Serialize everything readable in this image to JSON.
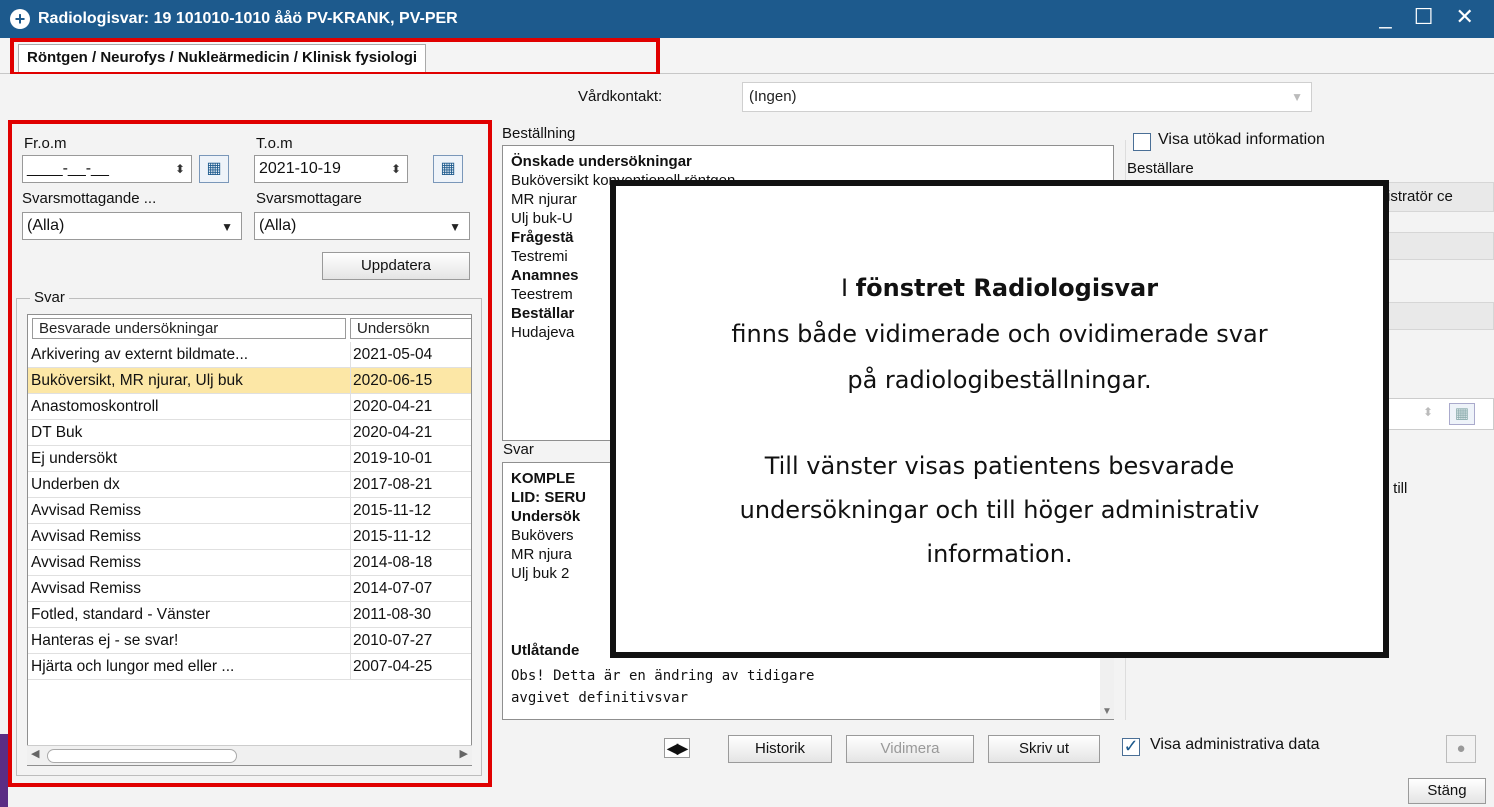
{
  "window": {
    "title": "Radiologisvar: 19 101010-1010 ååö PV-KRANK, PV-PER",
    "icon": "plus-cross-icon",
    "controls": "_ ☐ ✕"
  },
  "tabs": [
    {
      "label": "Röntgen / Neurofys / Nukleärmedicin / Klinisk fysiologi",
      "selected": true
    }
  ],
  "vardkontakt": {
    "label": "Vårdkontakt:",
    "value": "(Ingen)"
  },
  "filters": {
    "from_label": "Fr.o.m",
    "from_value": "____-__-__",
    "to_label": "T.o.m",
    "to_value": "2021-10-19",
    "recv_unit_label": "Svarsmottagande ...",
    "recv_unit_value": "(Alla)",
    "recv_label": "Svarsmottagare",
    "recv_value": "(Alla)",
    "update_button": "Uppdatera"
  },
  "svar_group": {
    "legend": "Svar",
    "columns": [
      "Besvarade undersökningar",
      "Undersökn"
    ],
    "rows": [
      {
        "name": "Arkivering av externt bildmate...",
        "date": "2021-05-04",
        "selected": false
      },
      {
        "name": "Buköversikt, MR njurar, Ulj buk",
        "date": "2020-06-15",
        "selected": true
      },
      {
        "name": "Anastomoskontroll",
        "date": "2020-04-21",
        "selected": false
      },
      {
        "name": "DT Buk",
        "date": "2020-04-21",
        "selected": false
      },
      {
        "name": "Ej undersökt",
        "date": "2019-10-01",
        "selected": false
      },
      {
        "name": "Underben dx",
        "date": "2017-08-21",
        "selected": false
      },
      {
        "name": "Avvisad Remiss",
        "date": "2015-11-12",
        "selected": false
      },
      {
        "name": "Avvisad Remiss",
        "date": "2015-11-12",
        "selected": false
      },
      {
        "name": "Avvisad Remiss",
        "date": "2014-08-18",
        "selected": false
      },
      {
        "name": "Avvisad Remiss",
        "date": "2014-07-07",
        "selected": false
      },
      {
        "name": "Fotled, standard - Vänster",
        "date": "2011-08-30",
        "selected": false
      },
      {
        "name": "Hanteras ej - se svar!",
        "date": "2010-07-27",
        "selected": false
      },
      {
        "name": "Hjärta och lungor  med eller ...",
        "date": "2007-04-25",
        "selected": false
      }
    ]
  },
  "bestallning": {
    "label": "Beställning",
    "lines": [
      {
        "text": "Önskade undersökningar",
        "bold": true
      },
      {
        "text": "Buköversikt konventionell röntgen",
        "bold": false
      },
      {
        "text": "MR njurar",
        "bold": false
      },
      {
        "text": "Ulj buk-U",
        "bold": false
      },
      {
        "text": "Frågestä",
        "bold": true
      },
      {
        "text": "Testremi",
        "bold": false
      },
      {
        "text": "Anamnes",
        "bold": true
      },
      {
        "text": "Teestrem",
        "bold": false
      },
      {
        "text": "Beställar",
        "bold": true
      },
      {
        "text": "Hudajeva",
        "bold": false
      }
    ]
  },
  "svar_text": {
    "label": "Svar",
    "lines": [
      {
        "text": "KOMPLE",
        "bold": true
      },
      {
        "text": "LID: SERU",
        "bold": true
      },
      {
        "text": "Undersök",
        "bold": true
      },
      {
        "text": "Bukövers",
        "bold": false
      },
      {
        "text": "MR njura",
        "bold": false
      },
      {
        "text": "Ulj buk 2",
        "bold": false
      }
    ],
    "utlatande_label": "Utlåtande",
    "mono_lines": [
      "Obs! Detta är en ändring av tidigare",
      "avgivet definitivsvar"
    ]
  },
  "admin": {
    "visa_utokad_label": "Visa utökad information",
    "bestallare_label": "Beställare",
    "partial_text_1": "istratör ce",
    "partial_text_2": "r till"
  },
  "toolbar": {
    "nav_arrows": "◀▶",
    "historik": "Historik",
    "vidimera": "Vidimera",
    "skriv_ut": "Skriv ut",
    "visa_admin_label": "Visa administrativa data",
    "visa_admin_checked": true,
    "stang": "Stäng"
  },
  "callout": {
    "line1_prefix": "I ",
    "line1_bold": "fönstret Radiologisvar",
    "line2": "finns både vidimerade och ovidimerade svar",
    "line3": "på radiologibeställningar.",
    "line4": "Till vänster visas patientens besvarade",
    "line5": "undersökningar och till höger administrativ",
    "line6": "information."
  },
  "colors": {
    "titlebar": "#1d5a8d",
    "highlight_red": "#e00000",
    "selected_row": "#fce7a6"
  }
}
